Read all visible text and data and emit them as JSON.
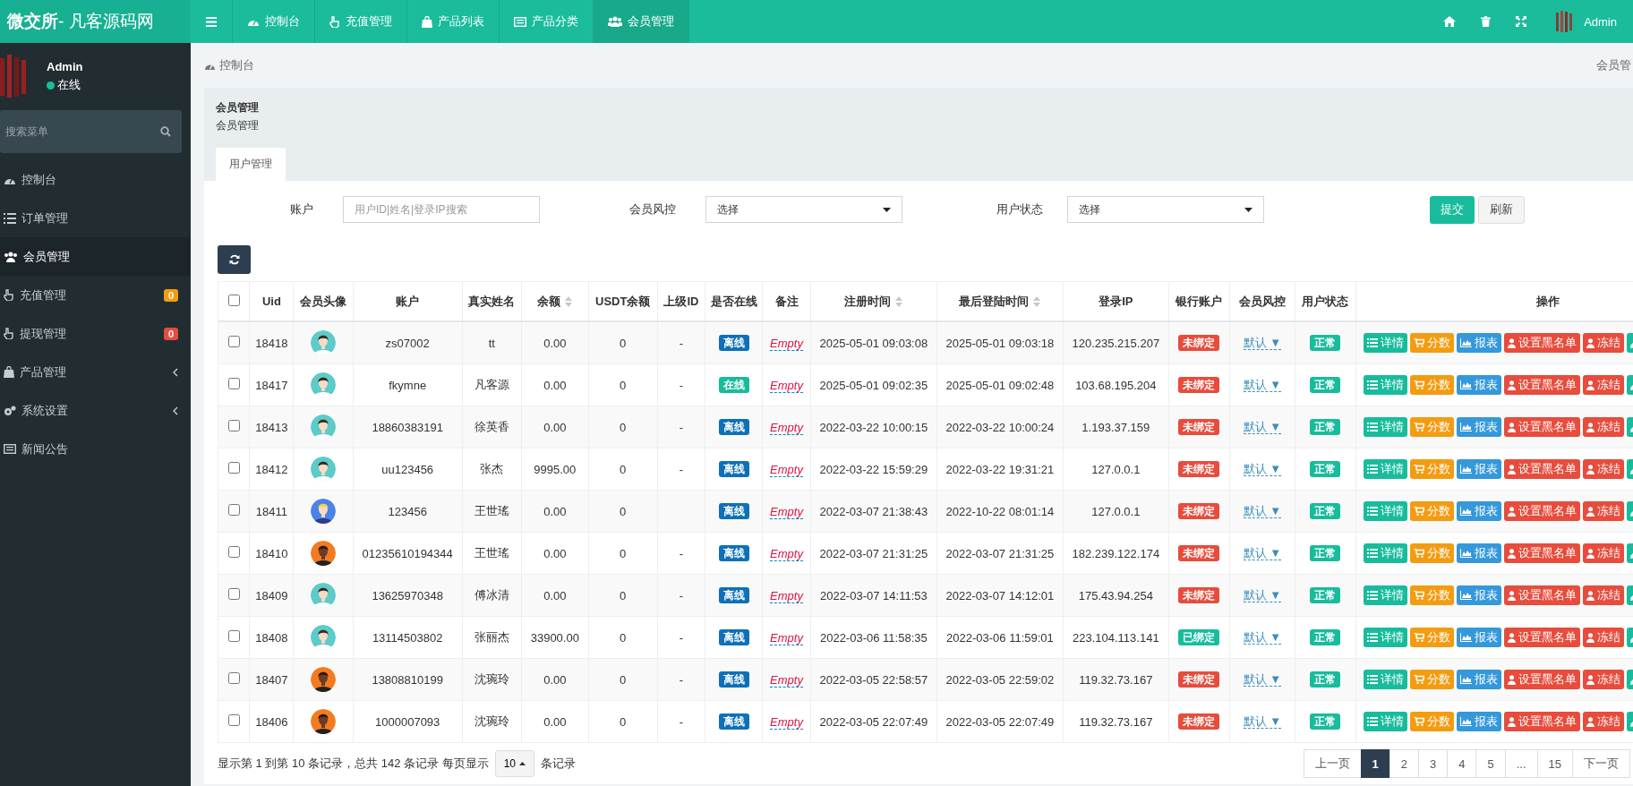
{
  "brand": {
    "name": "微交所",
    "suffix": "- 凡客源码网"
  },
  "top_nav": [
    {
      "label": "控制台",
      "selected": false
    },
    {
      "label": "充值管理",
      "selected": false
    },
    {
      "label": "产品列表",
      "selected": false
    },
    {
      "label": "产品分类",
      "selected": false
    },
    {
      "label": "会员管理",
      "selected": true
    }
  ],
  "top_right": {
    "user": "Admin"
  },
  "sidebar": {
    "user": {
      "name": "Admin",
      "status": "在线"
    },
    "search": {
      "placeholder": "搜索菜单"
    },
    "items": [
      {
        "label": "控制台",
        "selected": false
      },
      {
        "label": "订单管理",
        "selected": false
      },
      {
        "label": "会员管理",
        "selected": true
      },
      {
        "label": "充值管理",
        "selected": false,
        "badge": "0",
        "color": "#f39c12"
      },
      {
        "label": "提现管理",
        "selected": false,
        "badge": "0",
        "color": "#e74c3c"
      },
      {
        "label": "产品管理",
        "selected": false,
        "expanded": false
      },
      {
        "label": "系统设置",
        "selected": false,
        "expanded": false
      },
      {
        "label": "新闻公告",
        "selected": false
      }
    ]
  },
  "breadcrumb": {
    "label": "控制台",
    "right": "会员管"
  },
  "panel": {
    "title": "会员管理",
    "subtitle": "会员管理",
    "tabs": [
      {
        "label": "用户管理",
        "selected": true
      }
    ]
  },
  "filters": [
    {
      "label": "账户",
      "kind": "text",
      "placeholder": "用户ID|姓名|登录IP搜索"
    },
    {
      "label": "会员风控",
      "kind": "select",
      "value": "选择"
    },
    {
      "label": "用户状态",
      "kind": "select",
      "value": "选择"
    }
  ],
  "buttons": [
    {
      "label": "提交",
      "kind": "primary"
    },
    {
      "label": "刷新",
      "kind": "default"
    }
  ],
  "table": {
    "header_checked": false,
    "columns": [
      {
        "label": "Uid",
        "sortable": false
      },
      {
        "label": "会员头像",
        "sortable": false
      },
      {
        "label": "账户",
        "sortable": false
      },
      {
        "label": "真实姓名",
        "sortable": false
      },
      {
        "label": "余额",
        "sortable": true
      },
      {
        "label": "USDT余额",
        "sortable": false
      },
      {
        "label": "上级ID",
        "sortable": false
      },
      {
        "label": "是否在线",
        "sortable": false
      },
      {
        "label": "备注",
        "sortable": false
      },
      {
        "label": "注册时间",
        "sortable": true
      },
      {
        "label": "最后登陆时间",
        "sortable": true
      },
      {
        "label": "登录IP",
        "sortable": false
      },
      {
        "label": "银行账户",
        "sortable": false
      },
      {
        "label": "会员风控",
        "sortable": false
      },
      {
        "label": "用户状态",
        "sortable": false
      },
      {
        "label": "操作",
        "sortable": false
      }
    ],
    "rows": [
      {
        "checked": false,
        "uid": "18418",
        "avatar": {
          "kind": "man"
        },
        "account": "zs07002",
        "name": "tt",
        "balance": "0.00",
        "usdt": "0",
        "parent": "-",
        "online": false,
        "online_text": "离线",
        "note": "Empty",
        "registered": "2025-05-01 09:03:08",
        "last_login": "2025-05-01 09:03:18",
        "ip": "120.235.215.207",
        "bank_bound": false,
        "bank": "未绑定",
        "risk": "默认 ▼",
        "status": "正常",
        "actions": [
          {
            "kind": "detail",
            "label": "详情"
          },
          {
            "kind": "score",
            "label": "分数"
          },
          {
            "kind": "report",
            "label": "报表"
          },
          {
            "kind": "blacklist",
            "label": "设置黑名单"
          },
          {
            "kind": "freeze",
            "label": "冻结"
          },
          {
            "kind": "edit"
          }
        ]
      },
      {
        "checked": false,
        "uid": "18417",
        "avatar": {
          "kind": "man"
        },
        "account": "fkymne",
        "name": "凡客源",
        "balance": "0.00",
        "usdt": "0",
        "parent": "-",
        "online": true,
        "online_text": "在线",
        "note": "Empty",
        "registered": "2025-05-01 09:02:35",
        "last_login": "2025-05-01 09:02:48",
        "ip": "103.68.195.204",
        "bank_bound": false,
        "bank": "未绑定",
        "risk": "默认 ▼",
        "status": "正常",
        "actions": [
          {
            "kind": "detail",
            "label": "详情"
          },
          {
            "kind": "score",
            "label": "分数"
          },
          {
            "kind": "report",
            "label": "报表"
          },
          {
            "kind": "blacklist",
            "label": "设置黑名单"
          },
          {
            "kind": "freeze",
            "label": "冻结"
          },
          {
            "kind": "edit"
          }
        ]
      },
      {
        "checked": false,
        "uid": "18413",
        "avatar": {
          "kind": "man"
        },
        "account": "18860383191",
        "name": "徐英香",
        "balance": "0.00",
        "usdt": "0",
        "parent": "-",
        "online": false,
        "online_text": "离线",
        "note": "Empty",
        "registered": "2022-03-22 10:00:15",
        "last_login": "2022-03-22 10:00:24",
        "ip": "1.193.37.159",
        "bank_bound": false,
        "bank": "未绑定",
        "risk": "默认 ▼",
        "status": "正常",
        "actions": [
          {
            "kind": "detail",
            "label": "详情"
          },
          {
            "kind": "score",
            "label": "分数"
          },
          {
            "kind": "report",
            "label": "报表"
          },
          {
            "kind": "blacklist",
            "label": "设置黑名单"
          },
          {
            "kind": "freeze",
            "label": "冻结"
          },
          {
            "kind": "edit"
          }
        ]
      },
      {
        "checked": false,
        "uid": "18412",
        "avatar": {
          "kind": "man"
        },
        "account": "uu123456",
        "name": "张杰",
        "balance": "9995.00",
        "usdt": "0",
        "parent": "-",
        "online": false,
        "online_text": "离线",
        "note": "Empty",
        "registered": "2022-03-22 15:59:29",
        "last_login": "2022-03-22 19:31:21",
        "ip": "127.0.0.1",
        "bank_bound": false,
        "bank": "未绑定",
        "risk": "默认 ▼",
        "status": "正常",
        "actions": [
          {
            "kind": "detail",
            "label": "详情"
          },
          {
            "kind": "score",
            "label": "分数"
          },
          {
            "kind": "report",
            "label": "报表"
          },
          {
            "kind": "blacklist",
            "label": "设置黑名单"
          },
          {
            "kind": "freeze",
            "label": "冻结"
          },
          {
            "kind": "edit"
          }
        ]
      },
      {
        "checked": false,
        "uid": "18411",
        "avatar": {
          "kind": "blond"
        },
        "account": "123456",
        "name": "王世瑤",
        "balance": "0.00",
        "usdt": "0",
        "online": false,
        "online_text": "离线",
        "note": "Empty",
        "registered": "2022-03-07 21:38:43",
        "last_login": "2022-10-22 08:01:14",
        "ip": "127.0.0.1",
        "bank_bound": false,
        "bank": "未绑定",
        "risk": "默认 ▼",
        "status": "正常",
        "actions": [
          {
            "kind": "detail",
            "label": "详情"
          },
          {
            "kind": "score",
            "label": "分数"
          },
          {
            "kind": "report",
            "label": "报表"
          },
          {
            "kind": "blacklist",
            "label": "设置黑名单"
          },
          {
            "kind": "freeze",
            "label": "冻结"
          },
          {
            "kind": "edit"
          }
        ]
      },
      {
        "checked": false,
        "uid": "18410",
        "avatar": {
          "kind": "dark"
        },
        "account": "01235610194344",
        "name": "王世瑤",
        "balance": "0.00",
        "usdt": "0",
        "parent": "-",
        "online": false,
        "online_text": "离线",
        "note": "Empty",
        "registered": "2022-03-07 21:31:25",
        "last_login": "2022-03-07 21:31:25",
        "ip": "182.239.122.174",
        "bank_bound": false,
        "bank": "未绑定",
        "risk": "默认 ▼",
        "status": "正常",
        "actions": [
          {
            "kind": "detail",
            "label": "详情"
          },
          {
            "kind": "score",
            "label": "分数"
          },
          {
            "kind": "report",
            "label": "报表"
          },
          {
            "kind": "blacklist",
            "label": "设置黑名单"
          },
          {
            "kind": "freeze",
            "label": "冻结"
          },
          {
            "kind": "edit"
          }
        ]
      },
      {
        "checked": false,
        "uid": "18409",
        "avatar": {
          "kind": "man"
        },
        "account": "13625970348",
        "name": "傅冰清",
        "balance": "0.00",
        "usdt": "0",
        "parent": "-",
        "online": false,
        "online_text": "离线",
        "note": "Empty",
        "registered": "2022-03-07 14:11:53",
        "last_login": "2022-03-07 14:12:01",
        "ip": "175.43.94.254",
        "bank_bound": false,
        "bank": "未绑定",
        "risk": "默认 ▼",
        "status": "正常",
        "actions": [
          {
            "kind": "detail",
            "label": "详情"
          },
          {
            "kind": "score",
            "label": "分数"
          },
          {
            "kind": "report",
            "label": "报表"
          },
          {
            "kind": "blacklist",
            "label": "设置黑名单"
          },
          {
            "kind": "freeze",
            "label": "冻结"
          },
          {
            "kind": "edit"
          }
        ]
      },
      {
        "checked": false,
        "uid": "18408",
        "avatar": {
          "kind": "man"
        },
        "account": "13114503802",
        "name": "张丽杰",
        "balance": "33900.00",
        "usdt": "0",
        "parent": "-",
        "online": false,
        "online_text": "离线",
        "note": "Empty",
        "registered": "2022-03-06 11:58:35",
        "last_login": "2022-03-06 11:59:01",
        "ip": "223.104.113.141",
        "bank_bound": true,
        "bank": "已绑定",
        "risk": "默认 ▼",
        "status": "正常",
        "actions": [
          {
            "kind": "detail",
            "label": "详情"
          },
          {
            "kind": "score",
            "label": "分数"
          },
          {
            "kind": "report",
            "label": "报表"
          },
          {
            "kind": "blacklist",
            "label": "设置黑名单"
          },
          {
            "kind": "freeze",
            "label": "冻结"
          },
          {
            "kind": "edit"
          }
        ]
      },
      {
        "checked": false,
        "uid": "18407",
        "avatar": {
          "kind": "dark"
        },
        "account": "13808810199",
        "name": "沈琬玲",
        "balance": "0.00",
        "usdt": "0",
        "parent": "-",
        "online": false,
        "online_text": "离线",
        "note": "Empty",
        "registered": "2022-03-05 22:58:57",
        "last_login": "2022-03-05 22:59:02",
        "ip": "119.32.73.167",
        "bank_bound": false,
        "bank": "未绑定",
        "risk": "默认 ▼",
        "status": "正常",
        "actions": [
          {
            "kind": "detail",
            "label": "详情"
          },
          {
            "kind": "score",
            "label": "分数"
          },
          {
            "kind": "report",
            "label": "报表"
          },
          {
            "kind": "blacklist",
            "label": "设置黑名单"
          },
          {
            "kind": "freeze",
            "label": "冻结"
          },
          {
            "kind": "edit"
          }
        ]
      },
      {
        "checked": false,
        "uid": "18406",
        "avatar": {
          "kind": "dark"
        },
        "account": "1000007093",
        "name": "沈琬玲",
        "balance": "0.00",
        "usdt": "0",
        "parent": "-",
        "online": false,
        "online_text": "离线",
        "note": "Empty",
        "registered": "2022-03-05 22:07:49",
        "last_login": "2022-03-05 22:07:49",
        "ip": "119.32.73.167",
        "bank_bound": false,
        "bank": "未绑定",
        "risk": "默认 ▼",
        "status": "正常",
        "actions": [
          {
            "kind": "detail",
            "label": "详情"
          },
          {
            "kind": "score",
            "label": "分数"
          },
          {
            "kind": "report",
            "label": "报表"
          },
          {
            "kind": "blacklist",
            "label": "设置黑名单"
          },
          {
            "kind": "freeze",
            "label": "冻结"
          },
          {
            "kind": "edit"
          }
        ]
      }
    ]
  },
  "pagination": {
    "info": "显示第 1 到第 10 条记录，总共 142 条记录 每页显示",
    "page_size": "10",
    "suffix": "条记录",
    "pages": [
      {
        "label": "上一页",
        "selected": false
      },
      {
        "label": "1",
        "selected": true
      },
      {
        "label": "2",
        "selected": false
      },
      {
        "label": "3",
        "selected": false
      },
      {
        "label": "4",
        "selected": false
      },
      {
        "label": "5",
        "selected": false
      },
      {
        "label": "...",
        "selected": false
      },
      {
        "label": "15",
        "selected": false
      },
      {
        "label": "下一页",
        "selected": false
      }
    ]
  }
}
